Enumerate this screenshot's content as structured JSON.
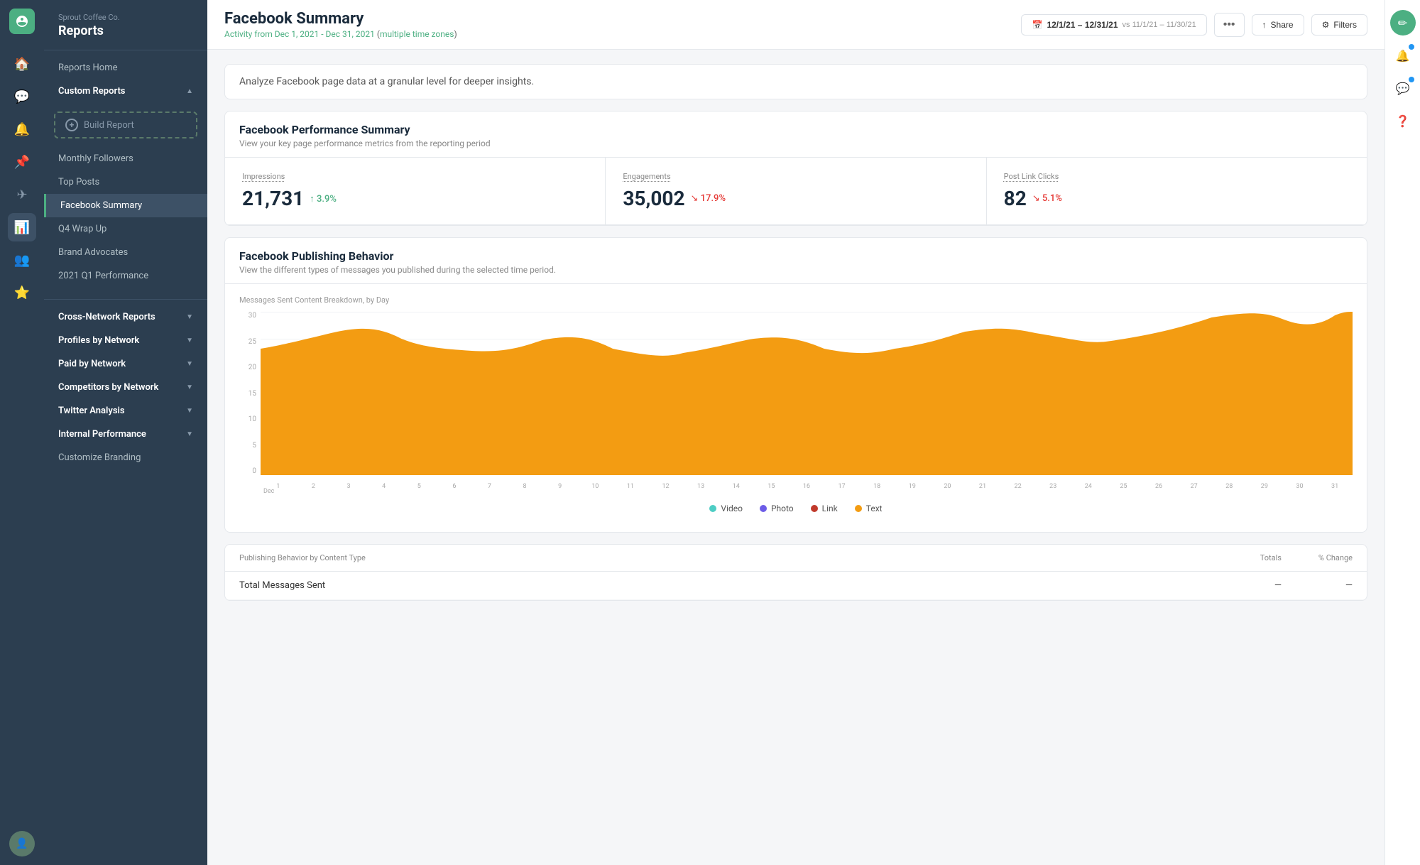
{
  "brand": {
    "company": "Sprout Coffee Co.",
    "section": "Reports"
  },
  "sidebar": {
    "reports_home": "Reports Home",
    "custom_reports_label": "Custom Reports",
    "build_report_label": "Build Report",
    "nav_items": [
      {
        "id": "monthly-followers",
        "label": "Monthly Followers"
      },
      {
        "id": "top-posts",
        "label": "Top Posts"
      },
      {
        "id": "facebook-summary",
        "label": "Facebook Summary",
        "active": true
      },
      {
        "id": "q4-wrap-up",
        "label": "Q4 Wrap Up"
      },
      {
        "id": "brand-advocates",
        "label": "Brand Advocates"
      },
      {
        "id": "2021-q1-performance",
        "label": "2021 Q1 Performance"
      }
    ],
    "section_items": [
      {
        "id": "cross-network",
        "label": "Cross-Network Reports"
      },
      {
        "id": "profiles-by-network",
        "label": "Profiles by Network"
      },
      {
        "id": "paid-by-network",
        "label": "Paid by Network"
      },
      {
        "id": "competitors-by-network",
        "label": "Competitors by Network"
      },
      {
        "id": "twitter-analysis",
        "label": "Twitter Analysis"
      },
      {
        "id": "internal-performance",
        "label": "Internal Performance"
      },
      {
        "id": "customize-branding",
        "label": "Customize Branding"
      }
    ]
  },
  "topbar": {
    "title": "Facebook Summary",
    "subtitle": "Activity from Dec 1, 2021 - Dec 31, 2021",
    "timezone_label": "multiple time zones",
    "date_range": "12/1/21 – 12/31/21",
    "vs_label": "vs 11/1/21 – 11/30/21",
    "share_label": "Share",
    "filters_label": "Filters"
  },
  "info_banner": {
    "text": "Analyze Facebook page data at a granular level for deeper insights."
  },
  "performance_card": {
    "title": "Facebook Performance Summary",
    "subtitle": "View your key page performance metrics from the reporting period",
    "metrics": [
      {
        "label": "Impressions",
        "value": "21,731",
        "change": "3.9%",
        "direction": "up"
      },
      {
        "label": "Engagements",
        "value": "35,002",
        "change": "17.9%",
        "direction": "down"
      },
      {
        "label": "Post Link Clicks",
        "value": "82",
        "change": "5.1%",
        "direction": "down"
      }
    ]
  },
  "publishing_card": {
    "title": "Facebook Publishing Behavior",
    "subtitle": "View the different types of messages you published during the selected time period.",
    "chart_label": "Messages Sent Content Breakdown, by Day",
    "y_labels": [
      "30",
      "25",
      "20",
      "15",
      "10",
      "5",
      "0"
    ],
    "x_labels": [
      "1",
      "2",
      "3",
      "4",
      "5",
      "6",
      "7",
      "8",
      "9",
      "10",
      "11",
      "12",
      "13",
      "14",
      "15",
      "16",
      "17",
      "18",
      "19",
      "20",
      "21",
      "22",
      "23",
      "24",
      "25",
      "26",
      "27",
      "28",
      "29",
      "30",
      "31"
    ],
    "x_sub_label": "Dec",
    "legend": [
      {
        "id": "video",
        "label": "Video",
        "color": "#4ecdc4"
      },
      {
        "id": "photo",
        "label": "Photo",
        "color": "#6c5ce7"
      },
      {
        "id": "link",
        "label": "Link",
        "color": "#c0392b"
      },
      {
        "id": "text",
        "label": "Text",
        "color": "#f39c12"
      }
    ]
  },
  "table_section": {
    "title": "Publishing Behavior by Content Type",
    "col_totals": "Totals",
    "col_change": "% Change",
    "row_label": "Total Messages Sent"
  },
  "colors": {
    "green": "#4caf82",
    "sidebar_bg": "#2c3e50",
    "video": "#4ecdc4",
    "photo": "#6c5ce7",
    "link": "#c0392b",
    "text_color": "#f39c12"
  }
}
